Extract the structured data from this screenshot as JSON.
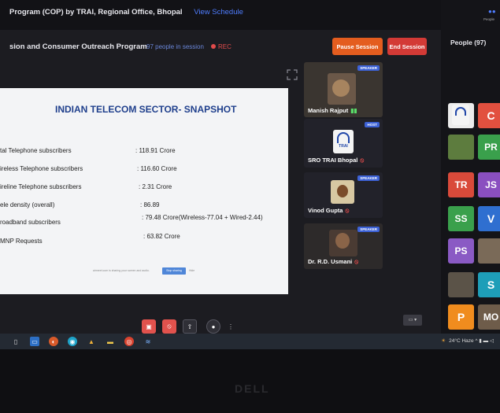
{
  "header": {
    "program_title": "Program (COP) by TRAI, Regional Office, Bhopal",
    "view_schedule": "View Schedule"
  },
  "session": {
    "name": "sion and Consumer Outreach Program",
    "people_count": "97 people in session",
    "rec": "REC",
    "pause_label": "Pause Session",
    "end_label": "End Session"
  },
  "slide": {
    "title": "INDIAN TELECOM SECTOR- SNAPSHOT",
    "rows": [
      {
        "label": "tal Telephone subscribers",
        "value": ": 118.91 Crore"
      },
      {
        "label": "ireless Telephone subscribers",
        "value": ": 116.60 Crore"
      },
      {
        "label": "ireline Telephone subscribers",
        "value": ": 2.31 Crore"
      },
      {
        "label": "ele density (overall)",
        "value": ": 86.89"
      },
      {
        "label": "roadband subscribers",
        "value": ": 79.48 Crore(Wireless-77.04 + Wired-2.44)"
      },
      {
        "label": "MNP Requests",
        "value": ": 63.82 Crore"
      }
    ],
    "share_text": "airmeet.com is sharing your screen and audio.",
    "stop_sharing": "Stop sharing",
    "hide": "Hide"
  },
  "speakers": [
    {
      "name": "Manish Rajput",
      "badge": "SPEAKER"
    },
    {
      "name": "SRO TRAI Bhopal",
      "badge": "HOST",
      "logo_text": "TRAI"
    },
    {
      "name": "Vinod Gupta",
      "badge": "SPEAKER"
    },
    {
      "name": "Dr. R.D. Usmani",
      "badge": "SPEAKER"
    }
  ],
  "people_panel": {
    "title": "People (97)",
    "icon_label": "People",
    "avatars": [
      "C",
      "PR",
      "TR",
      "JS",
      "SS",
      "V",
      "PS",
      "S",
      "P",
      "MO"
    ]
  },
  "taskbar": {
    "weather": "24°C Haze"
  },
  "laptop": {
    "brand": "DELL"
  },
  "colors": {
    "accent_blue": "#3d62d6",
    "pause_orange": "#e45d1f",
    "end_red": "#d33a36",
    "slide_title_blue": "#1f3f8c"
  }
}
